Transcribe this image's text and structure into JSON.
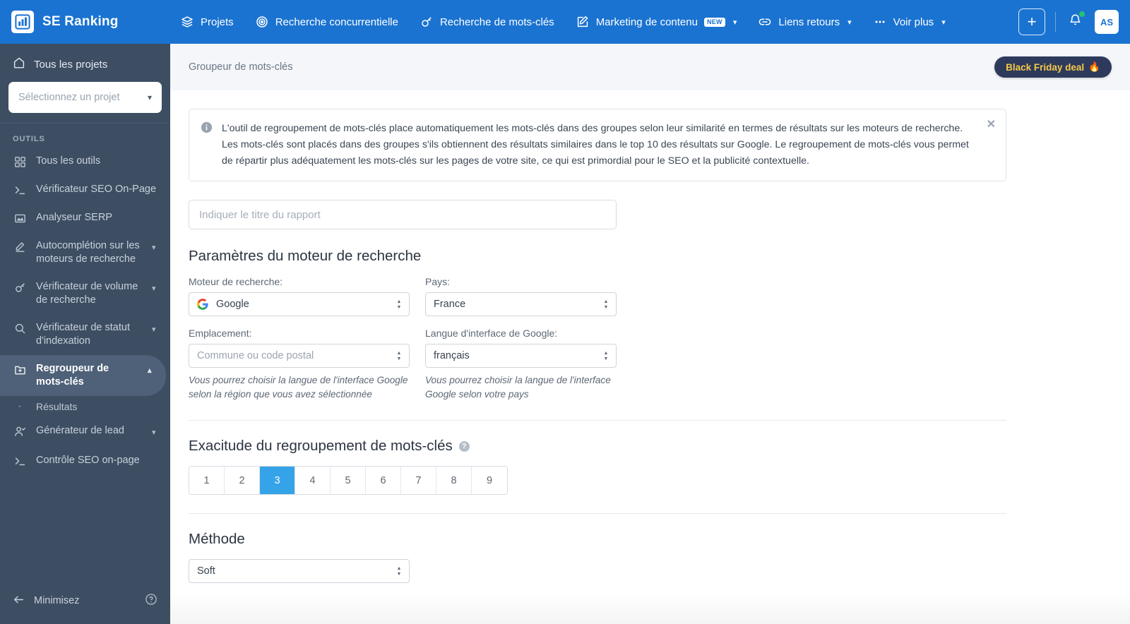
{
  "brand": {
    "name": "SE Ranking",
    "logo_icon": "bar-chart-icon"
  },
  "topnav": {
    "items": [
      {
        "label": "Projets",
        "icon": "layers-icon",
        "has_caret": false,
        "badge": ""
      },
      {
        "label": "Recherche concurrentielle",
        "icon": "target-icon",
        "has_caret": false,
        "badge": ""
      },
      {
        "label": "Recherche de mots-clés",
        "icon": "key-icon",
        "has_caret": false,
        "badge": ""
      },
      {
        "label": "Marketing de contenu",
        "icon": "pencil-square-icon",
        "has_caret": true,
        "badge": "NEW"
      },
      {
        "label": "Liens retours",
        "icon": "link-icon",
        "has_caret": true,
        "badge": ""
      },
      {
        "label": "Voir plus",
        "icon": "ellipsis-icon",
        "has_caret": true,
        "badge": ""
      }
    ],
    "add_button_label": "+",
    "avatar_initials": "AS"
  },
  "sidebar": {
    "all_projects_label": "Tous les projets",
    "project_select_placeholder": "Sélectionnez un projet",
    "tools_heading": "OUTILS",
    "items": [
      {
        "label": "Tous les outils",
        "icon": "grid-icon",
        "chevron": "",
        "active": false
      },
      {
        "label": "Vérificateur SEO On-Page",
        "icon": "terminal-icon",
        "chevron": "",
        "active": false
      },
      {
        "label": "Analyseur SERP",
        "icon": "mountain-icon",
        "chevron": "",
        "active": false
      },
      {
        "label": "Autocomplétion sur les moteurs de recherche",
        "icon": "pencil-icon",
        "chevron": "down",
        "active": false
      },
      {
        "label": "Vérificateur de volume de recherche",
        "icon": "key-icon",
        "chevron": "down",
        "active": false
      },
      {
        "label": "Vérificateur de statut d'indexation",
        "icon": "search-icon",
        "chevron": "down",
        "active": false
      },
      {
        "label": "Regroupeur de mots-clés",
        "icon": "folder-plus-icon",
        "chevron": "up",
        "active": true
      }
    ],
    "sub_item": {
      "label": "Résultats"
    },
    "items_after": [
      {
        "label": "Générateur de lead",
        "icon": "user-check-icon",
        "chevron": "down",
        "active": false
      },
      {
        "label": "Contrôle SEO on-page",
        "icon": "terminal-icon",
        "chevron": "",
        "active": false
      }
    ],
    "minimize_label": "Minimisez",
    "help_icon": "question-circle-icon"
  },
  "breadcrumb": {
    "label": "Groupeur de mots-clés"
  },
  "promo": {
    "label": "Black Friday deal",
    "emoji": "🔥"
  },
  "notice": {
    "icon": "info-icon",
    "text": "L'outil de regroupement de mots-clés place automatiquement les mots-clés dans des groupes selon leur similarité en termes de résultats sur les moteurs de recherche. Les mots-clés sont placés dans des groupes s'ils obtiennent des résultats similaires dans le top 10 des résultats sur Google. Le regroupement de mots-clés vous permet de répartir plus adéquatement les mots-clés sur les pages de votre site, ce qui est primordial pour le SEO et la publicité contextuelle.",
    "close_icon": "close-icon"
  },
  "form": {
    "report_title_placeholder": "Indiquer le titre du rapport",
    "report_title_value": "",
    "search_engine_section_title": "Paramètres du moteur de recherche",
    "search_engine": {
      "label": "Moteur de recherche:",
      "value": "Google",
      "icon": "google-icon"
    },
    "country": {
      "label": "Pays:",
      "value": "France"
    },
    "location": {
      "label": "Emplacement:",
      "value": "",
      "placeholder": "Commune ou code postal",
      "hint": "Vous pourrez choisir la langue de l'interface Google selon la région que vous avez sélectionnée"
    },
    "interface_language": {
      "label": "Langue d'interface de Google:",
      "value": "français",
      "hint": "Vous pourrez choisir la langue de l'interface Google selon votre pays"
    },
    "accuracy": {
      "title": "Exacitude du regroupement de mots-clés",
      "help_icon": "question-circle-icon",
      "options": [
        "1",
        "2",
        "3",
        "4",
        "5",
        "6",
        "7",
        "8",
        "9"
      ],
      "selected": "3"
    },
    "method": {
      "title": "Méthode",
      "value": "Soft"
    }
  },
  "colors": {
    "topbar_blue": "#1a73d1",
    "sidebar": "#3d4e63",
    "sidebar_active": "#4e6179",
    "accent_selected": "#35a3e8",
    "promo_bg": "#2d3a5c",
    "promo_text": "#f7c948",
    "crumbbar_bg": "#f4f6f9"
  }
}
